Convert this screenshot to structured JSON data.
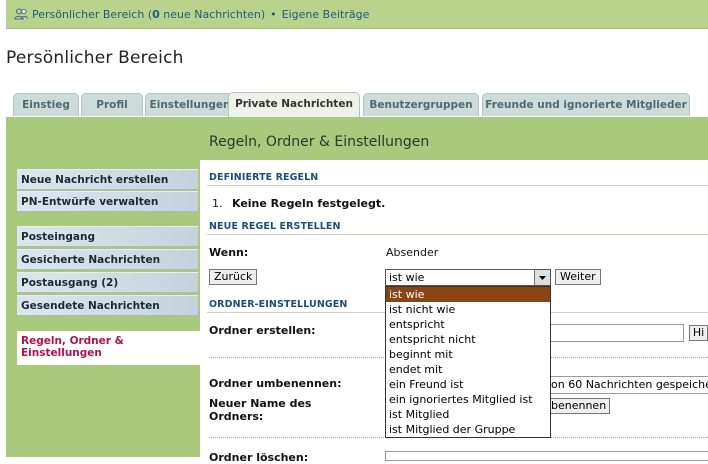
{
  "topbar": {
    "area_link_prefix": "Persönlicher Bereich (",
    "new_count": "0",
    "area_link_suffix": " neue Nachrichten)",
    "separator": "•",
    "own_posts_link": "Eigene Beiträge"
  },
  "page_title": "Persönlicher Bereich",
  "tabs": [
    {
      "label": "Einstieg"
    },
    {
      "label": "Profil"
    },
    {
      "label": "Einstellungen"
    },
    {
      "label": "Private Nachrichten"
    },
    {
      "label": "Benutzergruppen"
    },
    {
      "label": "Freunde und ignorierte Mitglieder"
    }
  ],
  "section_title": "Regeln, Ordner & Einstellungen",
  "sidebar": {
    "group1": [
      {
        "label": "Neue Nachricht erstellen"
      },
      {
        "label": "PN-Entwürfe verwalten"
      }
    ],
    "group2": [
      {
        "label": "Posteingang"
      },
      {
        "label": "Gesicherte Nachrichten"
      },
      {
        "label": "Postausgang (2)"
      },
      {
        "label": "Gesendete Nachrichten"
      }
    ],
    "active_line1": "Regeln, Ordner &",
    "active_line2": "Einstellungen"
  },
  "defined_rules": {
    "header": "Definierte Regeln",
    "item_number": "1.",
    "item_text": "Keine Regeln festgelegt."
  },
  "new_rule": {
    "header": "Neue Regel erstellen",
    "if_label": "Wenn:",
    "if_value": "Absender",
    "back_button": "Zurück",
    "condition_selected": "ist wie",
    "next_button": "Weiter",
    "condition_options": [
      "ist wie",
      "ist nicht wie",
      "entspricht",
      "entspricht nicht",
      "beginnt mit",
      "endet mit",
      "ein Freund ist",
      "ein ignoriertes Mitglied ist",
      "ist Mitglied",
      "ist Mitglied der Gruppe"
    ]
  },
  "folder_settings": {
    "header": "Ordner-Einstellungen",
    "create_label": "Ordner erstellen:",
    "create_input_value": "",
    "create_button": "Hi",
    "rename_label": "Ordner umbenennen:",
    "rename_select_value": "on 60 Nachrichten gespeiche",
    "new_name_label_line1": "Neuer Name des",
    "new_name_label_line2": "Ordners:",
    "rename_button": "benennen",
    "delete_label": "Ordner löschen:"
  }
}
